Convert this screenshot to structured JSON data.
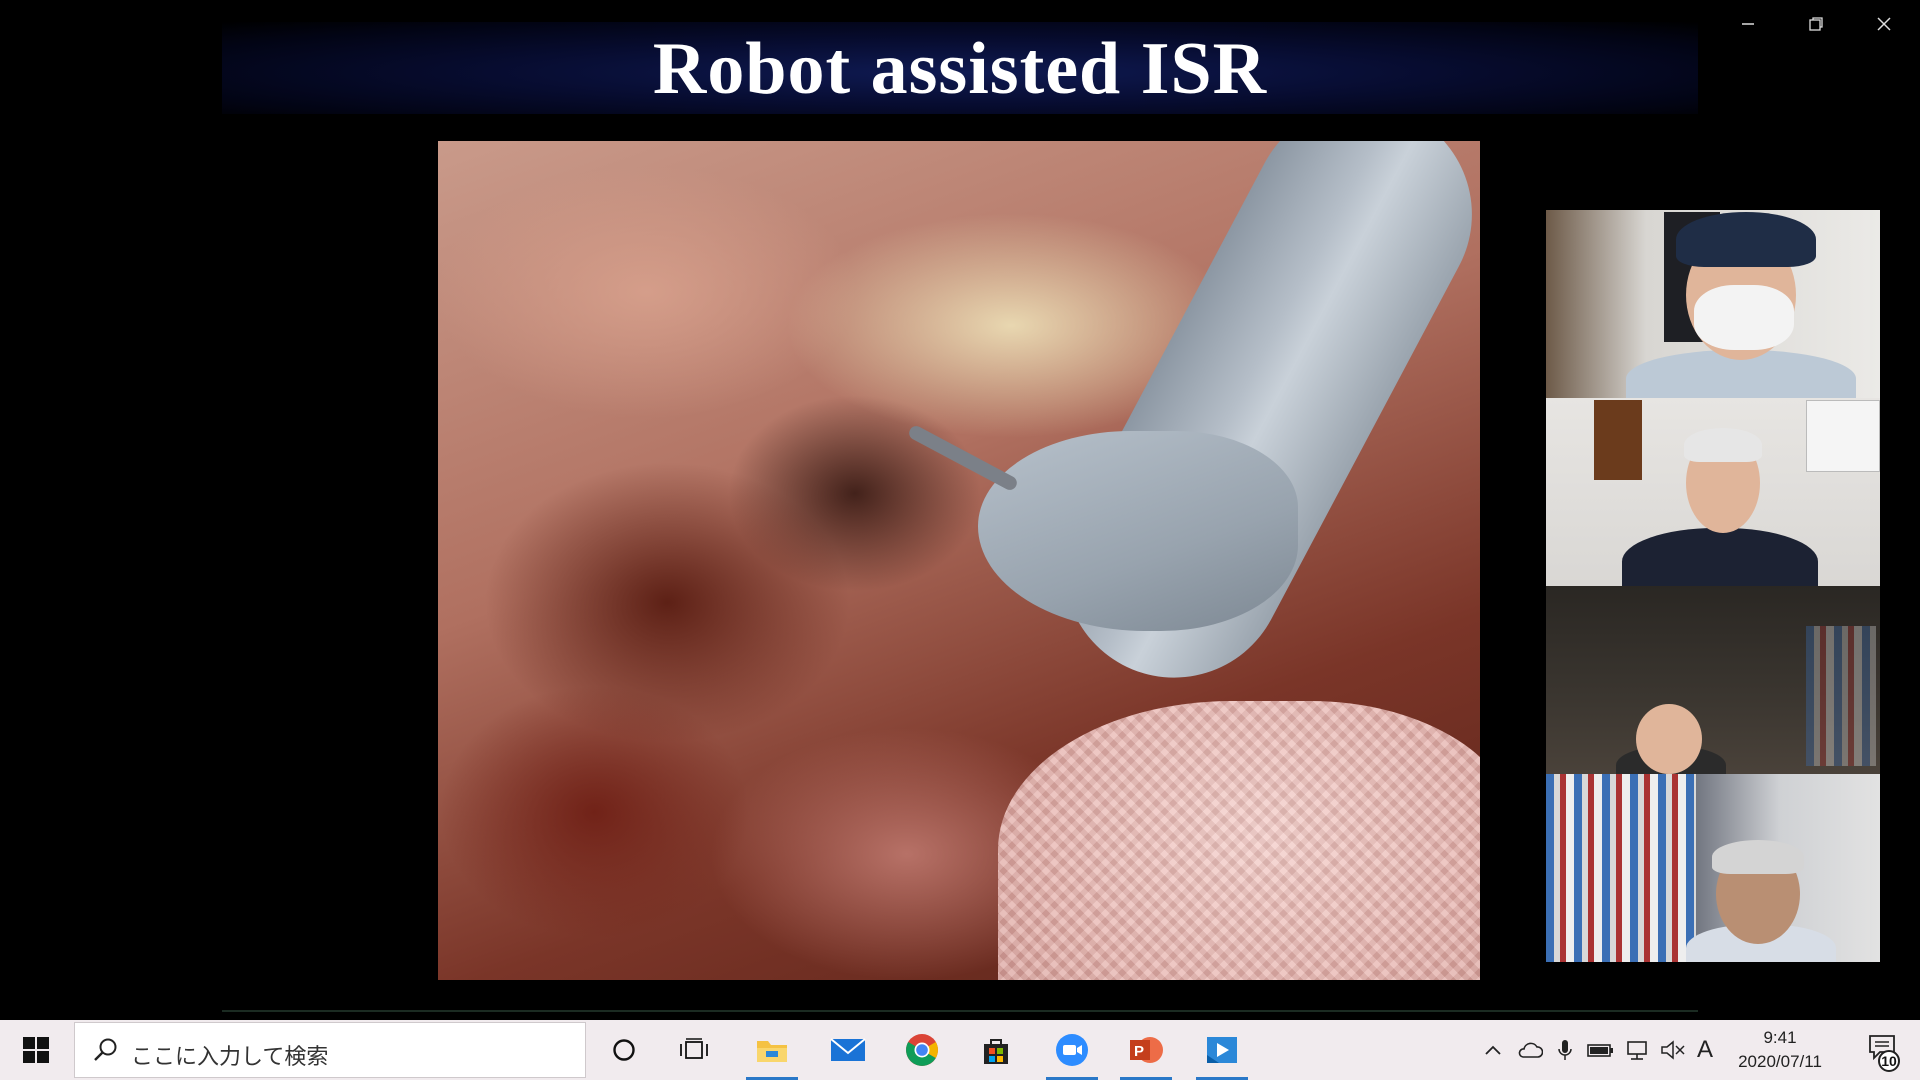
{
  "slide": {
    "title": "Robot assisted ISR"
  },
  "window_controls": {
    "minimize": "minimize-icon",
    "restore": "restore-icon",
    "close": "close-icon"
  },
  "video": {
    "description_icon": "surgical-video"
  },
  "participants": [
    {
      "icon": "participant-video"
    },
    {
      "icon": "participant-video"
    },
    {
      "icon": "participant-video"
    },
    {
      "icon": "participant-video"
    }
  ],
  "taskbar": {
    "search_placeholder": "ここに入力して検索",
    "apps": [
      "cortana-icon",
      "task-view-icon",
      "file-explorer-icon",
      "mail-icon",
      "chrome-icon",
      "store-icon",
      "zoom-icon",
      "powerpoint-icon",
      "media-player-icon"
    ],
    "tray_ime": "A",
    "clock_time": "9:41",
    "clock_date": "2020/07/11",
    "notification_count": "10"
  },
  "colors": {
    "taskbar_bg": "#f1ebee",
    "accent": "#2a78c8",
    "slide_header": "#0f1a52"
  }
}
